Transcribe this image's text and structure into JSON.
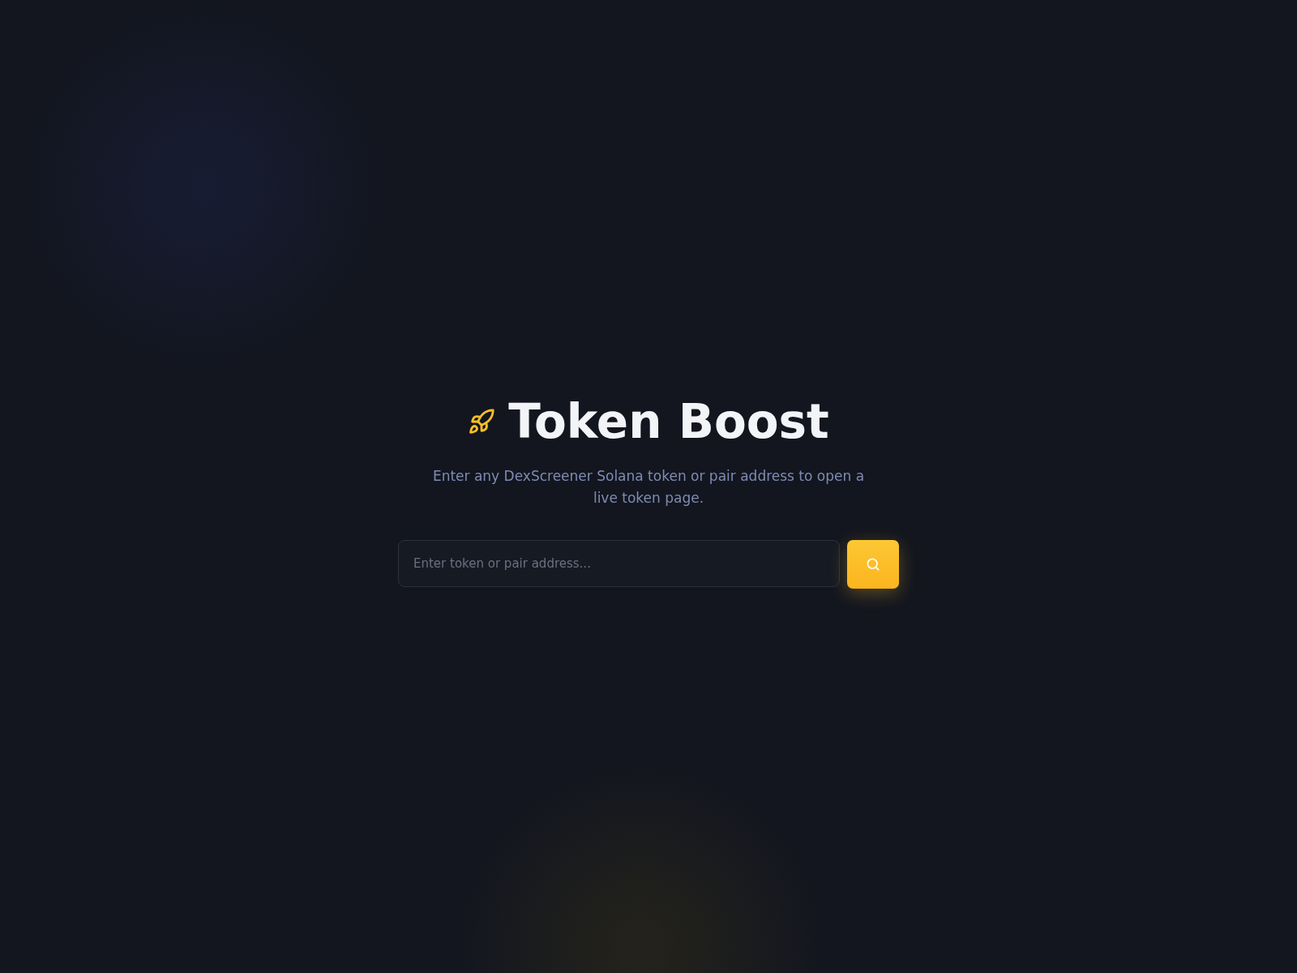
{
  "title": "Token Boost",
  "subtitle": "Enter any DexScreener Solana token or pair address to open a live token page.",
  "search": {
    "placeholder": "Enter token or pair address..."
  }
}
